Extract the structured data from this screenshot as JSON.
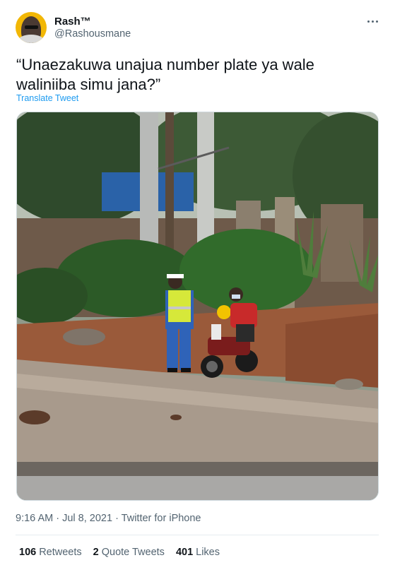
{
  "author": {
    "display_name": "Rash™",
    "handle": "@Rashousmane"
  },
  "tweet": {
    "text": "“Unaezakuwa unajua number plate ya wale waliniiba simu jana?”",
    "translate_label": "Translate Tweet"
  },
  "meta": {
    "time": "9:16 AM",
    "separator1": " · ",
    "date": "Jul 8, 2021",
    "separator2": " · ",
    "source": "Twitter for iPhone"
  },
  "stats": {
    "retweets_count": "106",
    "retweets_label": "Retweets",
    "quotes_count": "2",
    "quotes_label": "Quote Tweets",
    "likes_count": "401",
    "likes_label": "Likes"
  },
  "colors": {
    "accent": "#1d9bf0",
    "muted": "#536471",
    "text": "#0f1419"
  },
  "icons": {
    "more": "more-horizontal-icon"
  }
}
